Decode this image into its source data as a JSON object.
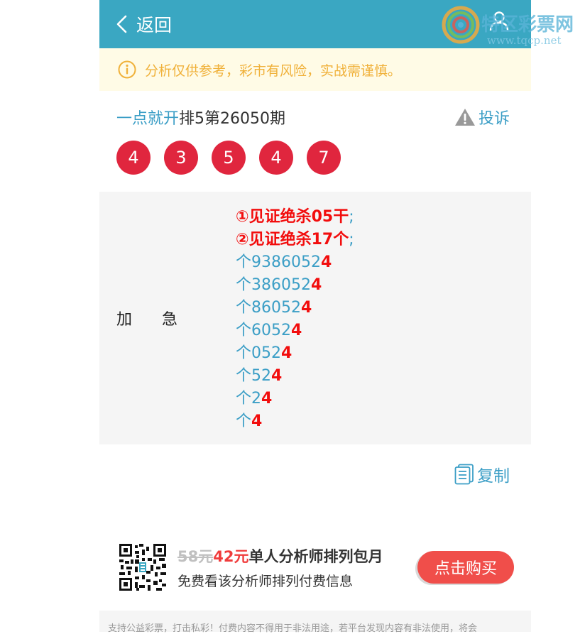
{
  "header": {
    "back_label": "返回",
    "bg_color": "#3aa7c2"
  },
  "watermark": {
    "title": "特区彩票网",
    "url": "www.tqcp.net"
  },
  "notice": {
    "icon": "info-circle-icon",
    "text": "分析仅供参考，彩市有风险，实战需谨慎。",
    "color": "#f0b13a"
  },
  "issue": {
    "prefix": "一点就开",
    "title": "排5第26050期",
    "report_label": "投诉"
  },
  "balls": [
    "4",
    "3",
    "5",
    "4",
    "7"
  ],
  "content": {
    "label_left": "加",
    "label_right": "急",
    "lines": [
      {
        "main": "①见证绝杀05干",
        "tail": ";"
      },
      {
        "main": "②见证绝杀17个",
        "tail": ";"
      },
      {
        "main": "个9386052",
        "tail": "4"
      },
      {
        "main": "个386052",
        "tail": "4"
      },
      {
        "main": "个86052",
        "tail": "4"
      },
      {
        "main": "个6052",
        "tail": "4"
      },
      {
        "main": "个052",
        "tail": "4"
      },
      {
        "main": "个52",
        "tail": "4"
      },
      {
        "main": "个2",
        "tail": "4"
      },
      {
        "main": "个",
        "tail": "4"
      }
    ]
  },
  "copy_label": "复制",
  "promo": {
    "old_price": "58元",
    "new_price": "42元",
    "offer_title": "单人分析师排列包月",
    "subtitle": "免费看该分析师排列付费信息",
    "buy_label": "点击购买"
  },
  "footer": {
    "text": "支持公益彩票，打击私彩！付费内容不得用于非法用途，若平台发现内容有非法使用，将会"
  }
}
